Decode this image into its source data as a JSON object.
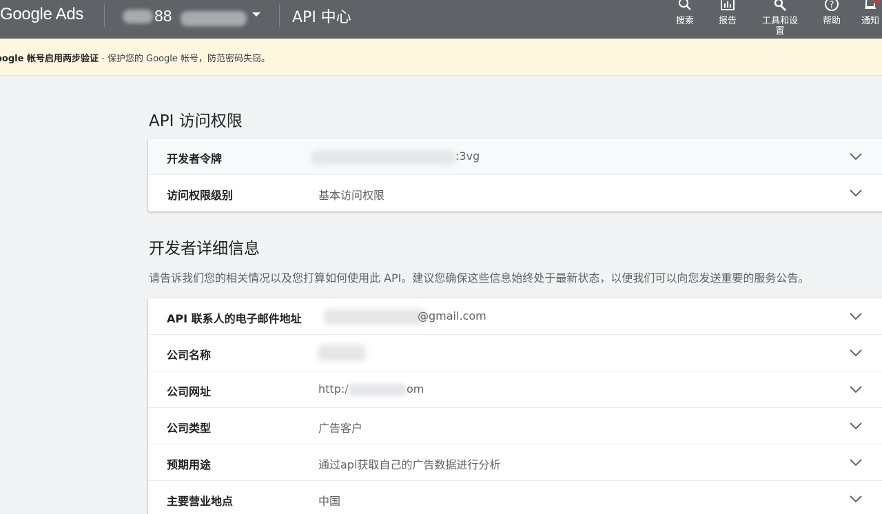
{
  "header": {
    "brand": "Google Ads",
    "account_fragment": "88",
    "page_title": "API 中心",
    "tools": [
      {
        "icon": "search-icon",
        "label": "搜索"
      },
      {
        "icon": "reports-icon",
        "label": "报告"
      },
      {
        "icon": "tools-icon",
        "label": "工具和设\n置"
      },
      {
        "icon": "help-icon",
        "label": "帮助"
      },
      {
        "icon": "notifications-icon",
        "label": "通知"
      }
    ]
  },
  "notice": {
    "bold": "oogle 帐号启用两步验证",
    "text": " - 保护您的 Google 帐号，防范密码失窃。"
  },
  "api_access": {
    "title": "API 访问权限",
    "rows": [
      {
        "label": "开发者令牌",
        "value": ":3vg"
      },
      {
        "label": "访问权限级别",
        "value": "基本访问权限"
      }
    ]
  },
  "developer_details": {
    "title": "开发者详细信息",
    "description": "请告诉我们您的相关情况以及您打算如何使用此 API。建议您确保这些信息始终处于最新状态，以便我们可以向您发送重要的服务公告。",
    "rows": [
      {
        "label": "API 联系人的电子邮件地址",
        "value": "@gmail.com"
      },
      {
        "label": "公司名称",
        "value": ""
      },
      {
        "label": "公司网址",
        "value_start": "http:/",
        "value_end": "om"
      },
      {
        "label": "公司类型",
        "value": "广告客户"
      },
      {
        "label": "预期用途",
        "value": "通过api获取自己的广告数据进行分析"
      },
      {
        "label": "主要营业地点",
        "value": "中国"
      }
    ]
  },
  "colors": {
    "topbar": "#5f6368",
    "notice_bg": "#fef7e0",
    "page_bg": "#f1f3f4",
    "card_bg": "#ffffff"
  }
}
